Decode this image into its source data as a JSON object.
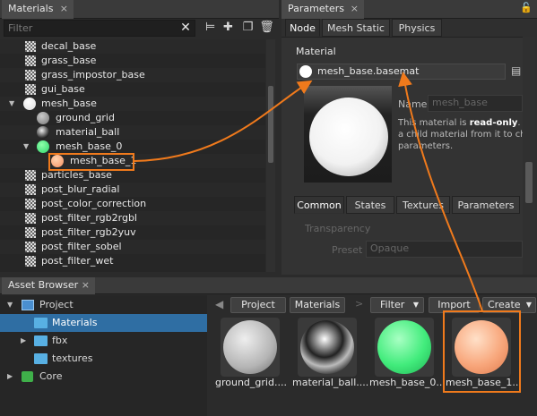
{
  "materials_panel": {
    "tab_label": "Materials",
    "close_glyph": "×",
    "filter_placeholder": "Filter",
    "tree": [
      {
        "label": "decal_base",
        "icon": "checker"
      },
      {
        "label": "grass_base",
        "icon": "checker"
      },
      {
        "label": "grass_impostor_base",
        "icon": "checker"
      },
      {
        "label": "gui_base",
        "icon": "checker"
      },
      {
        "label": "mesh_base",
        "icon": "white-ball"
      },
      {
        "label": "ground_grid",
        "icon": "gray-ball"
      },
      {
        "label": "material_ball",
        "icon": "chrome-ball"
      },
      {
        "label": "mesh_base_0",
        "icon": "green-ball"
      },
      {
        "label": "mesh_base_1",
        "icon": "orange-ball"
      },
      {
        "label": "particles_base",
        "icon": "checker"
      },
      {
        "label": "post_blur_radial",
        "icon": "checker"
      },
      {
        "label": "post_color_correction",
        "icon": "checker"
      },
      {
        "label": "post_filter_rgb2rgbl",
        "icon": "checker"
      },
      {
        "label": "post_filter_rgb2yuv",
        "icon": "checker"
      },
      {
        "label": "post_filter_sobel",
        "icon": "checker"
      },
      {
        "label": "post_filter_wet",
        "icon": "checker"
      }
    ]
  },
  "parameters_panel": {
    "tab_label": "Parameters",
    "close_glyph": "×",
    "tabs": [
      "Node",
      "Mesh Static",
      "Physics"
    ],
    "material_label": "Material",
    "material_value": "mesh_base.basemat",
    "name_label": "Name",
    "name_value": "mesh_base",
    "desc_line1_a": "This material is ",
    "desc_line1_b": "read-only",
    "desc_line1_c": ". Y",
    "desc_line2": "a child material from it to cha",
    "desc_line3": "parameters.",
    "sub_tabs": [
      "Common",
      "States",
      "Textures",
      "Parameters"
    ],
    "transparency_label": "Transparency",
    "preset_label": "Preset",
    "preset_value": "Opaque"
  },
  "asset_browser": {
    "tab_label": "Asset Browser",
    "close_glyph": "×",
    "tree": [
      {
        "label": "Project",
        "icon": "project-icon"
      },
      {
        "label": "Materials",
        "icon": "folder-icon"
      },
      {
        "label": "fbx",
        "icon": "folder-icon"
      },
      {
        "label": "textures",
        "icon": "folder-icon"
      },
      {
        "label": "Core",
        "icon": "core-icon"
      }
    ],
    "breadcrumb": [
      "Project",
      "Materials"
    ],
    "filter_button": "Filter",
    "import_button": "Import",
    "create_button": "Create",
    "thumbnails": [
      {
        "caption": "ground_grid....",
        "color": "#bdbdbd"
      },
      {
        "caption": "material_ball....",
        "color": "#777777"
      },
      {
        "caption": "mesh_base_0...",
        "color": "#3dec7a"
      },
      {
        "caption": "mesh_base_1...",
        "color": "#f7a77a"
      }
    ]
  },
  "colors": {
    "highlight": "#f07a1c",
    "selection": "#2f6ea3",
    "folder": "#58b0e3"
  }
}
